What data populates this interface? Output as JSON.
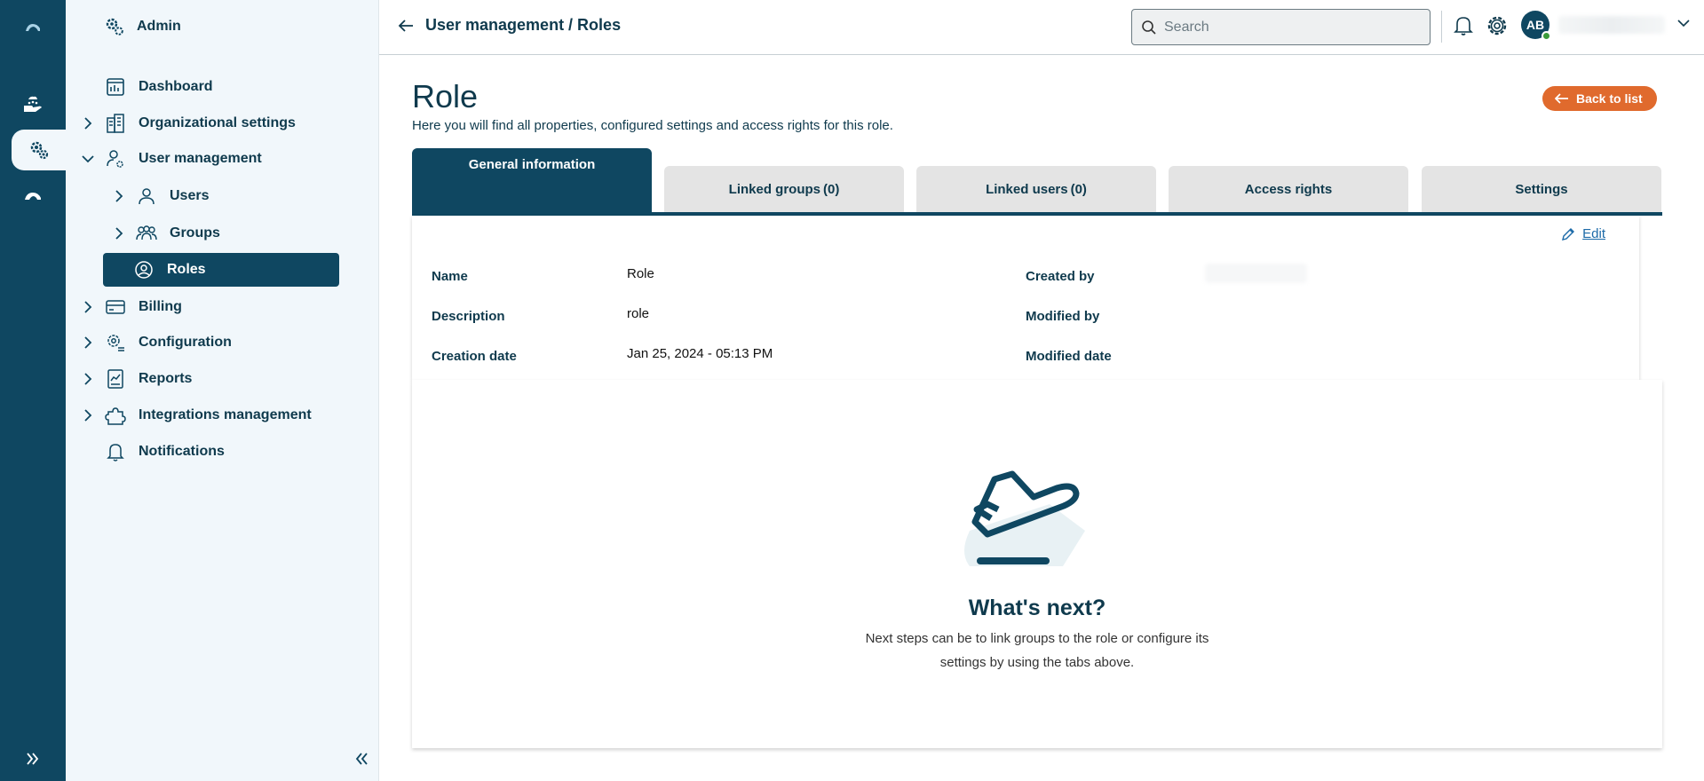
{
  "rail": {
    "items": [
      "cloud-logo-icon",
      "hand-cloud-icon",
      "gear-icon",
      "cloud-icon"
    ],
    "active_index": 2
  },
  "sidebar": {
    "title": "Admin",
    "items": [
      {
        "label": "Dashboard",
        "icon": "dashboard-icon",
        "expandable": false
      },
      {
        "label": "Organizational settings",
        "icon": "building-icon",
        "expandable": true
      },
      {
        "label": "User management",
        "icon": "user-gear-icon",
        "expandable": true,
        "expanded": true
      },
      {
        "label": "Users",
        "icon": "user-icon",
        "expandable": true,
        "child": true
      },
      {
        "label": "Groups",
        "icon": "group-icon",
        "expandable": true,
        "child": true
      },
      {
        "label": "Roles",
        "icon": "user-circle-icon",
        "expandable": false,
        "child": true,
        "active": true
      },
      {
        "label": "Billing",
        "icon": "billing-icon",
        "expandable": true
      },
      {
        "label": "Configuration",
        "icon": "configuration-icon",
        "expandable": true
      },
      {
        "label": "Reports",
        "icon": "reports-icon",
        "expandable": true
      },
      {
        "label": "Integrations management",
        "icon": "puzzle-icon",
        "expandable": true
      },
      {
        "label": "Notifications",
        "icon": "bell-icon",
        "expandable": false
      }
    ]
  },
  "topbar": {
    "breadcrumb": "User management / Roles",
    "search_placeholder": "Search",
    "avatar_initials": "AB"
  },
  "page": {
    "title": "Role",
    "subtitle": "Here you will find all properties, configured settings and access rights for this role.",
    "back_label": "Back to list"
  },
  "tabs": [
    {
      "label": "General information",
      "active": true
    },
    {
      "label": "Linked groups (0)",
      "active": false
    },
    {
      "label": "Linked users (0)",
      "active": false
    },
    {
      "label": "Access rights",
      "active": false
    },
    {
      "label": "Settings",
      "active": false
    }
  ],
  "info": {
    "edit_label": "Edit",
    "fields": {
      "name_label": "Name",
      "name_value": "Role",
      "description_label": "Description",
      "description_value": "role",
      "creation_date_label": "Creation date",
      "creation_date_value": "Jan 25, 2024 - 05:13 PM",
      "created_by_label": "Created by",
      "created_by_value": "",
      "modified_by_label": "Modified by",
      "modified_by_value": "",
      "modified_date_label": "Modified date",
      "modified_date_value": ""
    }
  },
  "next": {
    "title": "What's next?",
    "text": "Next steps can be to link groups to the role or configure its settings by using the tabs above."
  },
  "colors": {
    "primary": "#0f4761",
    "accent": "#e06a2d",
    "sidebar_bg": "#f1f7fb",
    "tab_inactive": "#e4e4e4",
    "link": "#1c6aa8",
    "status_online": "#3a9b3a"
  }
}
